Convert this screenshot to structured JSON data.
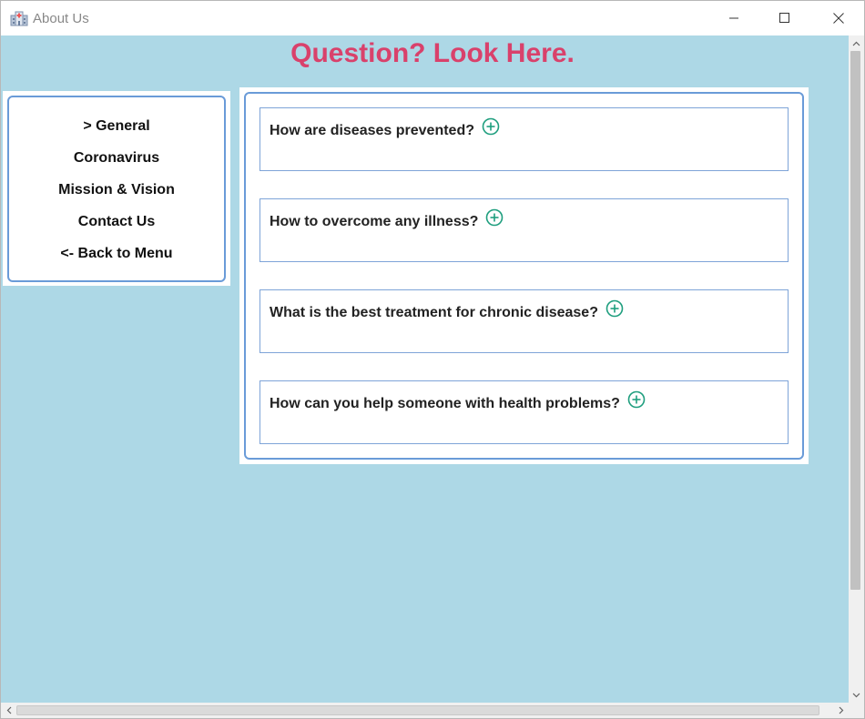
{
  "window": {
    "title": "About Us",
    "controls": {
      "minimize": "minimize-icon",
      "maximize": "maximize-icon",
      "close": "close-icon"
    }
  },
  "heading": "Question? Look Here.",
  "sidebar": {
    "items": [
      {
        "label": "> General",
        "icon": ""
      },
      {
        "label": "Coronavirus"
      },
      {
        "label": "Mission & Vision"
      },
      {
        "label": "Contact Us"
      },
      {
        "label": "<- Back to Menu"
      }
    ]
  },
  "faq": {
    "items": [
      {
        "question": "How are diseases prevented?",
        "icon": "plus-circle-icon"
      },
      {
        "question": "How to overcome any illness?",
        "icon": "plus-circle-icon"
      },
      {
        "question": "What is the best treatment for chronic disease?",
        "icon": "plus-circle-icon"
      },
      {
        "question": "How can you help someone with health problems?",
        "icon": "plus-circle-icon"
      }
    ]
  },
  "colors": {
    "background": "#add8e6",
    "heading": "#d9416b",
    "panel_border": "#6a9bd8",
    "icon_accent": "#1e9e7e"
  }
}
